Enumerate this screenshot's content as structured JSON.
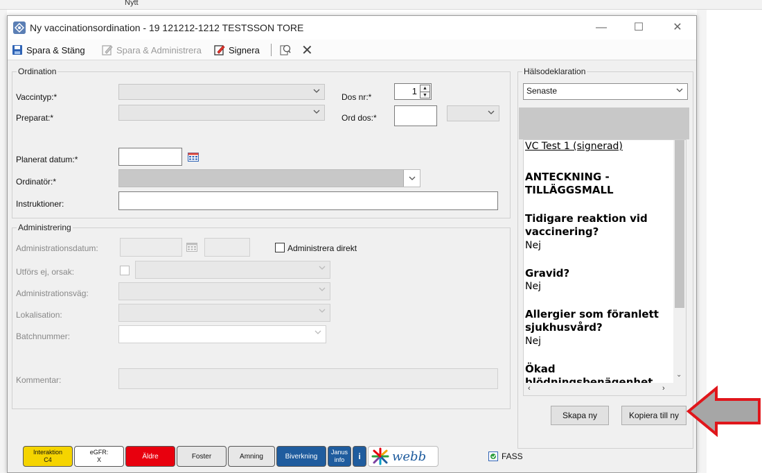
{
  "background": {
    "tab_text": "Nytt"
  },
  "window": {
    "title": "Ny vaccinationsordination - 19 121212-1212 TESTSSON TORE"
  },
  "toolbar": {
    "save_close": "Spara & Stäng",
    "save_admin": "Spara & Administrera",
    "sign": "Signera"
  },
  "ordination": {
    "legend": "Ordination",
    "vaccintyp_label": "Vaccintyp:*",
    "preparat_label": "Preparat:*",
    "dos_nr_label": "Dos nr:*",
    "dos_nr_value": "1",
    "ord_dos_label": "Ord dos:*",
    "planerat_datum_label": "Planerat datum:*",
    "ordinator_label": "Ordinatör:*",
    "instruktioner_label": "Instruktioner:"
  },
  "administrering": {
    "legend": "Administrering",
    "adm_datum_label": "Administrationsdatum:",
    "administrera_direkt_label": "Administrera direkt",
    "utfors_ej_label": "Utförs ej, orsak:",
    "adm_vag_label": "Administrationsväg:",
    "lokalisation_label": "Lokalisation:",
    "batchnummer_label": "Batchnummer:",
    "kommentar_label": "Kommentar:"
  },
  "halsodeklaration": {
    "legend": "Hälsodeklaration",
    "selected": "Senaste",
    "doc_title": "VC Test 1  (signerad)",
    "heading": "ANTECKNING - TILLÄGGSMALL",
    "q1": "Tidigare reaktion vid vaccinering?",
    "a1": "Nej",
    "q2": "Gravid?",
    "a2": "Nej",
    "q3": "Allergier som föranlett sjukhusvård?",
    "a3": "Nej",
    "q4": "Ökad",
    "q4_cut": "blödningsbenägenhet",
    "btn_create": "Skapa ny",
    "btn_copy": "Kopiera till ny"
  },
  "bottom_tags": {
    "interaktion": "Interaktion",
    "interaktion_sub": "C4",
    "egfr": "eGFR:",
    "egfr_sub": "X",
    "aldre": "Äldre",
    "foster": "Foster",
    "amning": "Amning",
    "biverkning": "Biverkning",
    "janus": "Janus",
    "janus_sub": "info",
    "info": "i",
    "webb": "webb",
    "fass": "FASS"
  },
  "colors": {
    "interaktion_bg": "#f5d400",
    "aldre_bg": "#e8000e",
    "blue_tag_bg": "#1f5c9e",
    "arrow_red": "#e0161b",
    "arrow_grey": "#a6a6a6"
  }
}
